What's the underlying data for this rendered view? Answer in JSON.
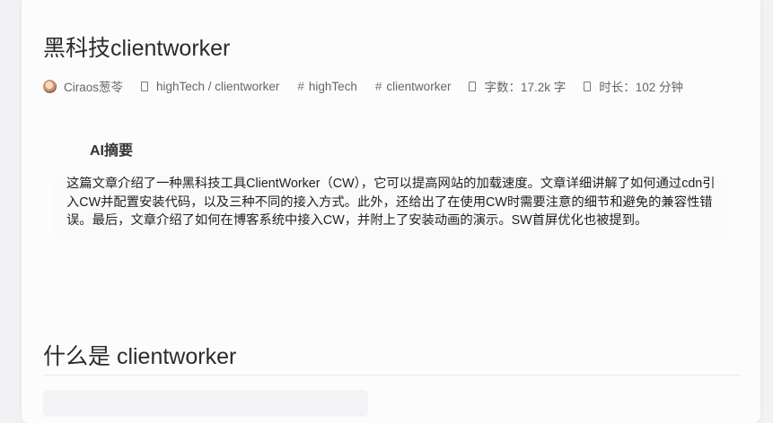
{
  "post": {
    "title": "黑科技clientworker",
    "meta": {
      "author": "Ciraos葱苓",
      "category": "highTech / clientworker",
      "tags": [
        "highTech",
        "clientworker"
      ],
      "word_count": "字数：17.2k 字",
      "duration": "时长：102 分钟"
    },
    "summary": {
      "heading": "AI摘要",
      "text": "这篇文章介绍了一种黑科技工具ClientWorker（CW），它可以提高网站的加载速度。文章详细讲解了如何通过cdn引入CW并配置安装代码，以及三种不同的接入方式。此外，还给出了在使用CW时需要注意的细节和避免的兼容性错误。最后，文章介绍了如何在博客系统中接入CW，并附上了安装动画的演示。SW首屏优化也被提到。"
    },
    "section_heading": "什么是 clientworker"
  },
  "colors": {
    "page_bg": "#f2f1f4",
    "card_bg": "#fdfcfd",
    "text": "#2b2b2b",
    "meta_text": "#666666"
  },
  "icons": {
    "author": "avatar",
    "category": "folder-icon",
    "tag": "hash-icon",
    "word_count": "file-text-icon",
    "duration": "clock-icon"
  }
}
